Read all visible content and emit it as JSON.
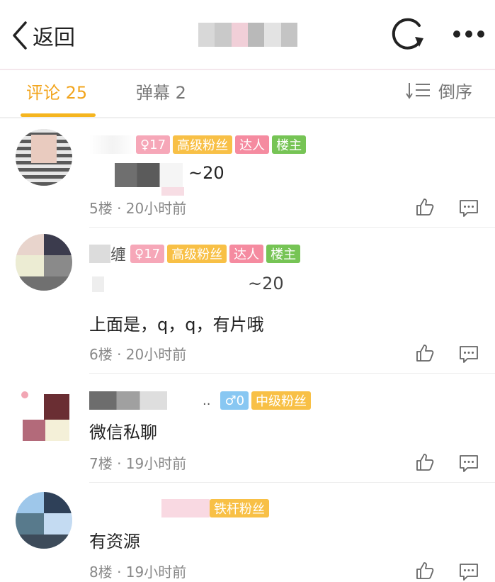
{
  "header": {
    "back_label": "返回",
    "title_blurred": true
  },
  "tabs": [
    {
      "label": "评论 25",
      "active": true
    },
    {
      "label": "弹幕 2",
      "active": false
    }
  ],
  "sort_label": "倒序",
  "colors": {
    "accent": "#f5b51f",
    "level": "#f6a7b8",
    "fan": "#f8c046",
    "daren": "#f58ba0",
    "louzhu": "#76c455",
    "male": "#88c7f2"
  },
  "comments": [
    {
      "badges": {
        "level": "♀17",
        "fan": "高级粉丝",
        "daren": "达人",
        "louzhu": "楼主"
      },
      "text": "~20",
      "meta": "5楼 · 20小时前"
    },
    {
      "name_partial": "缠",
      "badges": {
        "level": "♀17",
        "fan": "高级粉丝",
        "daren": "达人",
        "louzhu": "楼主"
      },
      "quote": "~20",
      "text": "上面是，q，q，有片哦",
      "meta": "6楼 · 20小时前"
    },
    {
      "name_suffix": "..",
      "badges": {
        "male": "♂0",
        "fan": "中级粉丝"
      },
      "text": "微信私聊",
      "meta": "7楼 · 19小时前"
    },
    {
      "badges": {
        "fan": "铁杆粉丝"
      },
      "text": "有资源",
      "meta": "8楼 · 19小时前"
    }
  ],
  "icons": {
    "like": "thumb-up-icon",
    "reply": "comment-icon",
    "refresh": "refresh-icon",
    "more": "more-icon",
    "back": "chevron-left-icon",
    "sort": "sort-icon"
  }
}
